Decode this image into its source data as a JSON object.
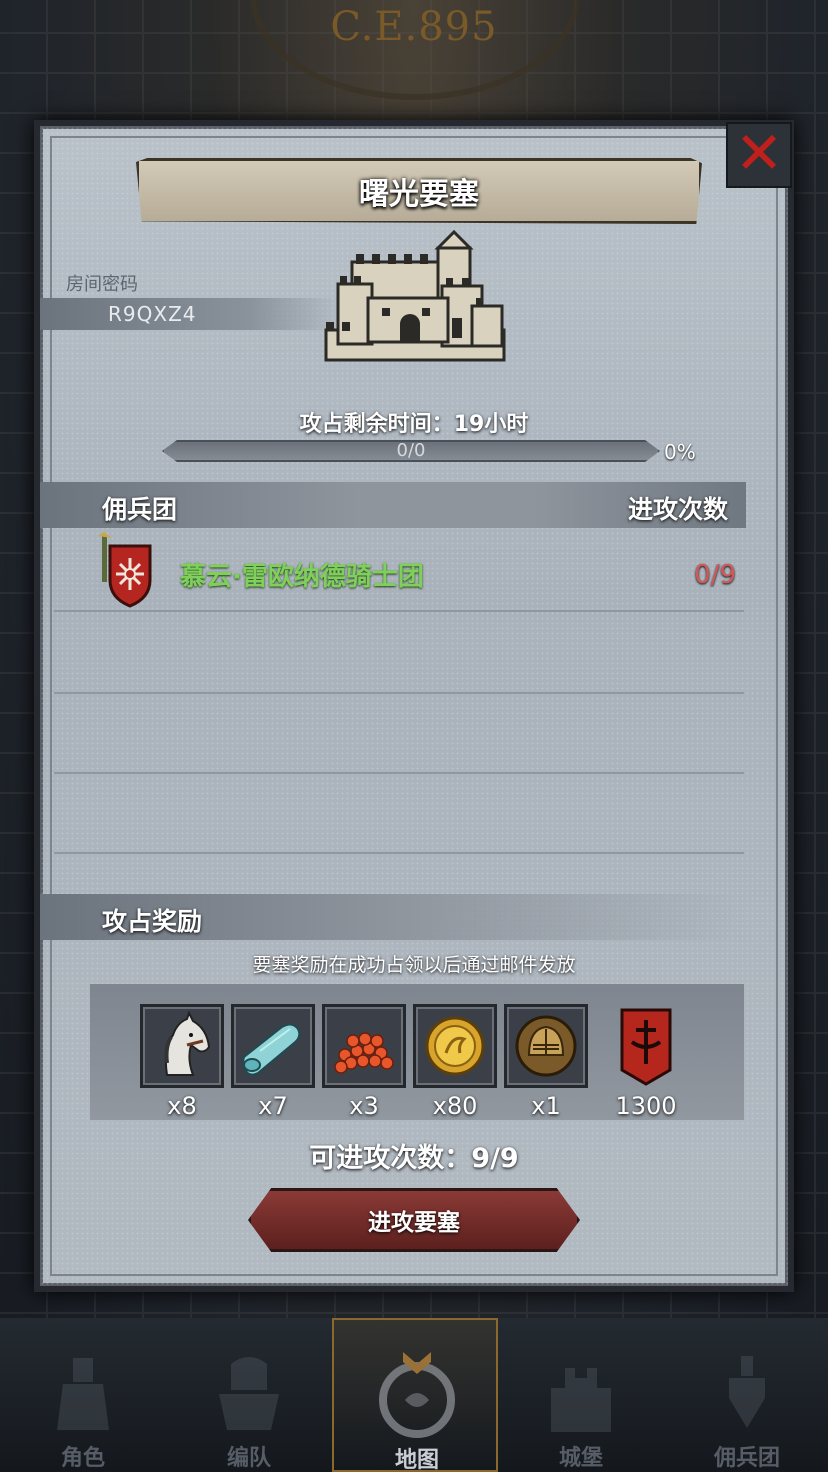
{
  "header": {
    "era": "C.E.895"
  },
  "dialog": {
    "title": "曙光要塞",
    "room": {
      "label": "房间密码",
      "code": "R9QXZ4"
    },
    "time": {
      "label": "攻占剩余时间：",
      "value": "19",
      "unit": "小时"
    },
    "progress": {
      "text": "0/0",
      "percent_label": "0%",
      "fraction": 0
    },
    "mercenary_section": {
      "left_header": "佣兵团",
      "right_header": "进攻次数"
    },
    "mercenaries": [
      {
        "name": "慕云·雷欧纳德骑士团",
        "attacks": "0/9",
        "icon": "shield-emblem-icon"
      }
    ],
    "reward_section": {
      "header": "攻占奖励",
      "note": "要塞奖励在成功占领以后通过邮件发放",
      "items": [
        {
          "icon": "horse-icon",
          "qty": "x8"
        },
        {
          "icon": "cloth-roll-icon",
          "qty": "x7"
        },
        {
          "icon": "beans-icon",
          "qty": "x3"
        },
        {
          "icon": "gold-coin-icon",
          "qty": "x80"
        },
        {
          "icon": "knight-helmet-icon",
          "qty": "x1"
        },
        {
          "icon": "guild-banner-icon",
          "qty": "1300"
        }
      ]
    },
    "attack_count": {
      "label": "可进攻次数：",
      "value": "9/9"
    },
    "attack_button": "进攻要塞",
    "close_icon": "close-icon"
  },
  "nav": [
    {
      "label": "角色",
      "icon": "character-icon"
    },
    {
      "label": "编队",
      "icon": "formation-icon"
    },
    {
      "label": "地图",
      "icon": "map-icon",
      "active": true
    },
    {
      "label": "城堡",
      "icon": "castle-icon"
    },
    {
      "label": "佣兵团",
      "icon": "mercenary-icon"
    }
  ],
  "colors": {
    "accent_green": "#7fd05a",
    "attack_red": "#d2595a",
    "close_red": "#c0201c"
  }
}
